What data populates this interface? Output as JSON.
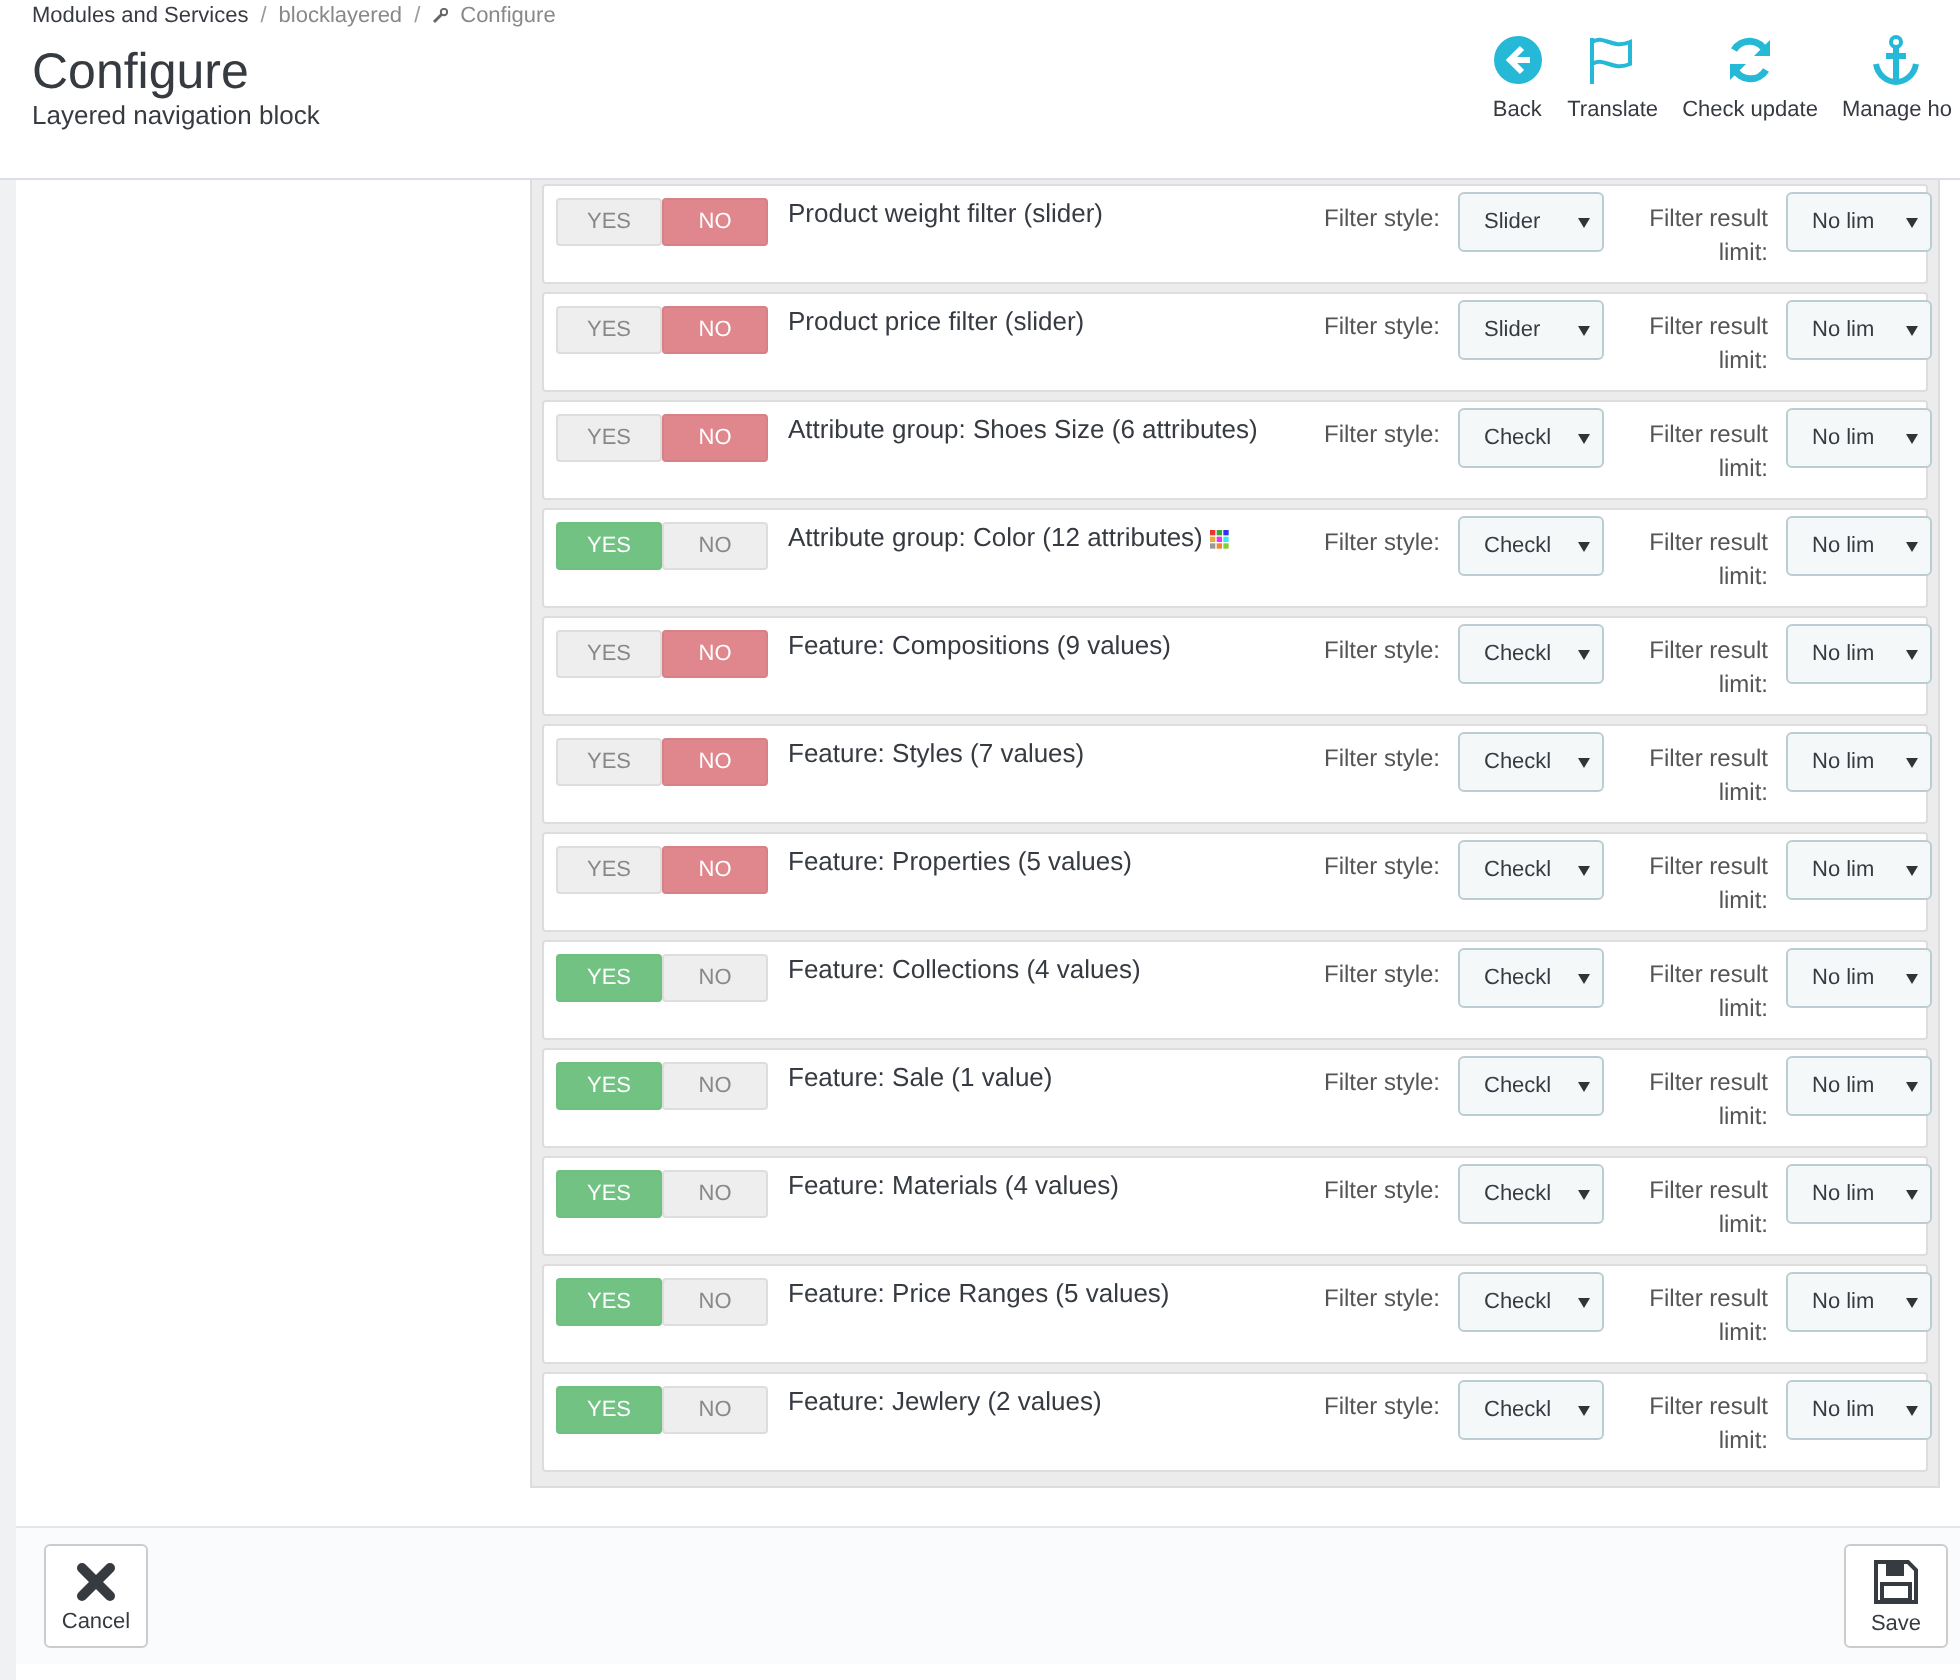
{
  "breadcrumb": [
    {
      "label": "Modules and Services",
      "separator": "/"
    },
    {
      "label": "blocklayered",
      "separator": "/"
    },
    {
      "label": "Configure"
    }
  ],
  "title": "Configure",
  "subtitle": "Layered navigation block",
  "toolbar": [
    {
      "kind": "back",
      "label": "Back"
    },
    {
      "kind": "flag",
      "label": "Translate"
    },
    {
      "kind": "refresh",
      "label": "Check update"
    },
    {
      "kind": "anchor",
      "label": "Manage ho"
    }
  ],
  "filters": [
    {
      "yes": "YES",
      "no": "NO",
      "label": "Product weight filter (slider)",
      "enabled": false,
      "palette": false,
      "filter_style_label": "Filter style:",
      "filter_style": "Slider",
      "limit_label": "Filter result limit:",
      "limit": "No lim"
    },
    {
      "yes": "YES",
      "no": "NO",
      "label": "Product price filter (slider)",
      "enabled": false,
      "palette": false,
      "filter_style_label": "Filter style:",
      "filter_style": "Slider",
      "limit_label": "Filter result limit:",
      "limit": "No lim"
    },
    {
      "yes": "YES",
      "no": "NO",
      "label": "Attribute group: Shoes Size (6 attributes)",
      "enabled": false,
      "palette": false,
      "filter_style_label": "Filter style:",
      "filter_style": "Checkl",
      "limit_label": "Filter result limit:",
      "limit": "No lim"
    },
    {
      "yes": "YES",
      "no": "NO",
      "label": "Attribute group: Color (12 attributes)",
      "enabled": true,
      "palette": true,
      "filter_style_label": "Filter style:",
      "filter_style": "Checkl",
      "limit_label": "Filter result limit:",
      "limit": "No lim"
    },
    {
      "yes": "YES",
      "no": "NO",
      "label": "Feature: Compositions (9 values)",
      "enabled": false,
      "palette": false,
      "filter_style_label": "Filter style:",
      "filter_style": "Checkl",
      "limit_label": "Filter result limit:",
      "limit": "No lim"
    },
    {
      "yes": "YES",
      "no": "NO",
      "label": "Feature: Styles (7 values)",
      "enabled": false,
      "palette": false,
      "filter_style_label": "Filter style:",
      "filter_style": "Checkl",
      "limit_label": "Filter result limit:",
      "limit": "No lim"
    },
    {
      "yes": "YES",
      "no": "NO",
      "label": "Feature: Properties (5 values)",
      "enabled": false,
      "palette": false,
      "filter_style_label": "Filter style:",
      "filter_style": "Checkl",
      "limit_label": "Filter result limit:",
      "limit": "No lim"
    },
    {
      "yes": "YES",
      "no": "NO",
      "label": "Feature: Collections (4 values)",
      "enabled": true,
      "palette": false,
      "filter_style_label": "Filter style:",
      "filter_style": "Checkl",
      "limit_label": "Filter result limit:",
      "limit": "No lim"
    },
    {
      "yes": "YES",
      "no": "NO",
      "label": "Feature: Sale (1 value)",
      "enabled": true,
      "palette": false,
      "filter_style_label": "Filter style:",
      "filter_style": "Checkl",
      "limit_label": "Filter result limit:",
      "limit": "No lim"
    },
    {
      "yes": "YES",
      "no": "NO",
      "label": "Feature: Materials (4 values)",
      "enabled": true,
      "palette": false,
      "filter_style_label": "Filter style:",
      "filter_style": "Checkl",
      "limit_label": "Filter result limit:",
      "limit": "No lim"
    },
    {
      "yes": "YES",
      "no": "NO",
      "label": "Feature: Price Ranges (5 values)",
      "enabled": true,
      "palette": false,
      "filter_style_label": "Filter style:",
      "filter_style": "Checkl",
      "limit_label": "Filter result limit:",
      "limit": "No lim"
    },
    {
      "yes": "YES",
      "no": "NO",
      "label": "Feature: Jewlery (2 values)",
      "enabled": true,
      "palette": false,
      "filter_style_label": "Filter style:",
      "filter_style": "Checkl",
      "limit_label": "Filter result limit:",
      "limit": "No lim"
    }
  ],
  "footer": [
    {
      "kind": "cancel",
      "label": "Cancel"
    },
    {
      "kind": "save",
      "label": "Save"
    }
  ]
}
